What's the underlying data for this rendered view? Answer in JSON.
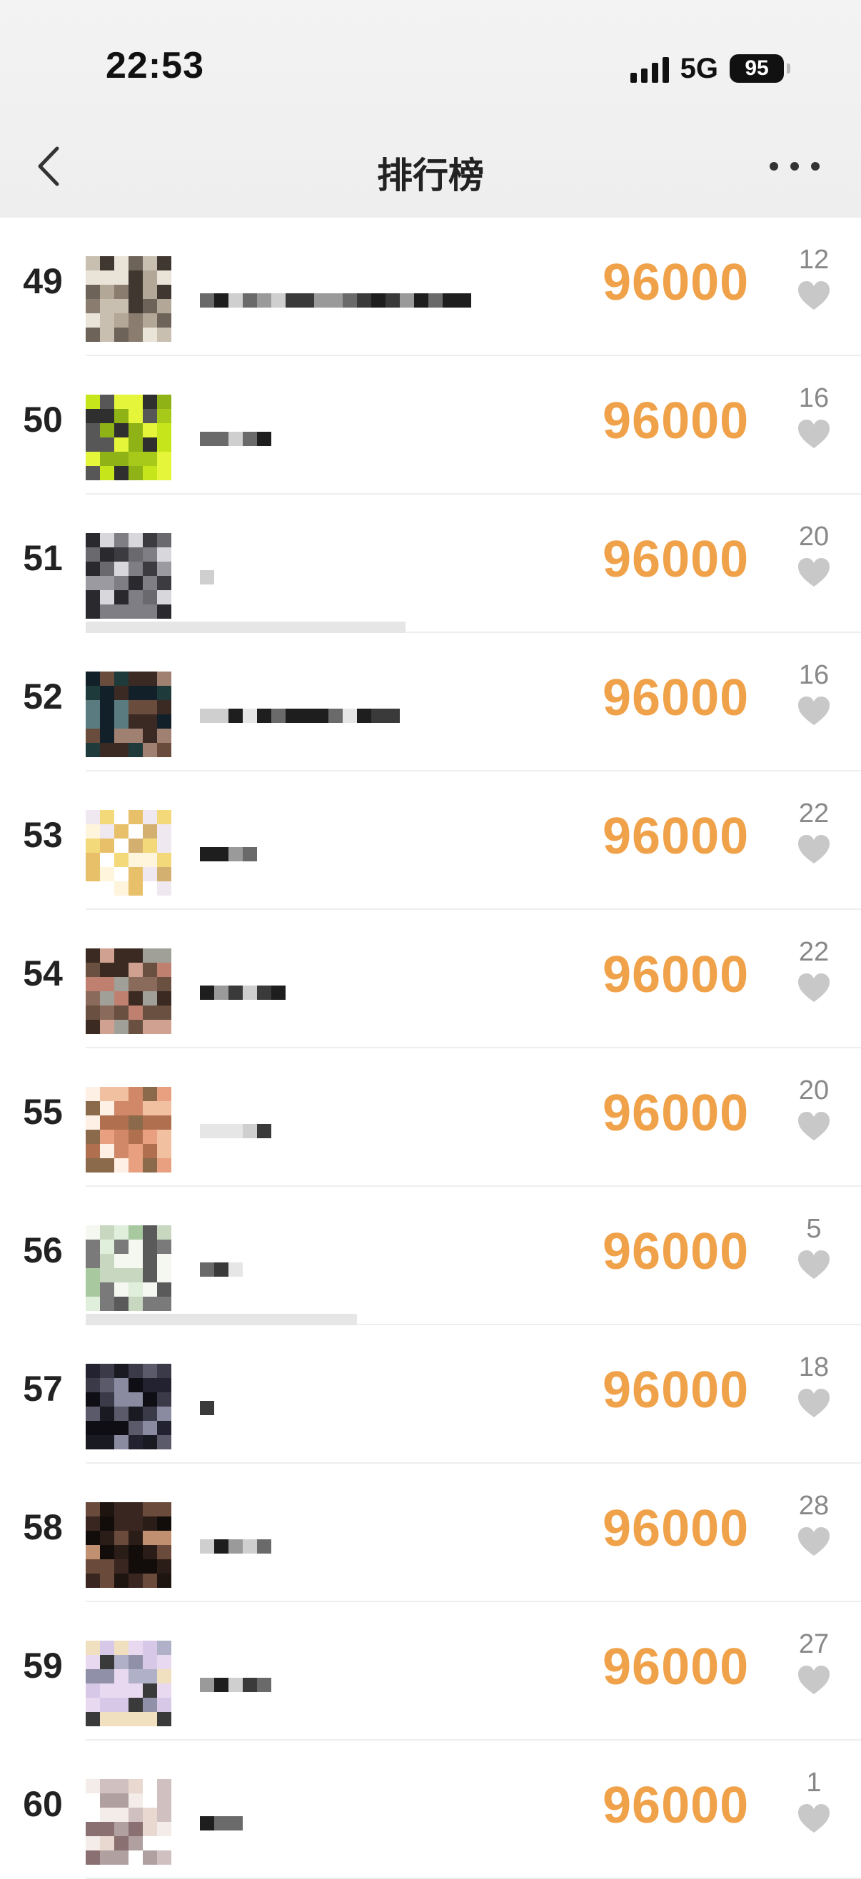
{
  "status_bar": {
    "time": "22:53",
    "network": "5G",
    "battery": "95"
  },
  "header": {
    "title": "排行榜"
  },
  "colors": {
    "score": "#f0a24a",
    "heart": "#c8c8c8",
    "like_count": "#888888"
  },
  "icons": {
    "back": "chevron-left-icon",
    "more": "more-horizontal-icon",
    "like": "heart-icon",
    "signal": "signal-icon"
  },
  "rows": [
    {
      "rank": "49",
      "name": "",
      "score": "96000",
      "likes": "12"
    },
    {
      "rank": "50",
      "name": "",
      "score": "96000",
      "likes": "16"
    },
    {
      "rank": "51",
      "name": "",
      "score": "96000",
      "likes": "20"
    },
    {
      "rank": "52",
      "name": "",
      "score": "96000",
      "likes": "16"
    },
    {
      "rank": "53",
      "name": "",
      "score": "96000",
      "likes": "22"
    },
    {
      "rank": "54",
      "name": "",
      "score": "96000",
      "likes": "22"
    },
    {
      "rank": "55",
      "name": "",
      "score": "96000",
      "likes": "20"
    },
    {
      "rank": "56",
      "name": "",
      "score": "96000",
      "likes": "5"
    },
    {
      "rank": "57",
      "name": "",
      "score": "96000",
      "likes": "18"
    },
    {
      "rank": "58",
      "name": "",
      "score": "96000",
      "likes": "28"
    },
    {
      "rank": "59",
      "name": "",
      "score": "96000",
      "likes": "27"
    },
    {
      "rank": "60",
      "name": "",
      "score": "96000",
      "likes": "1"
    }
  ]
}
